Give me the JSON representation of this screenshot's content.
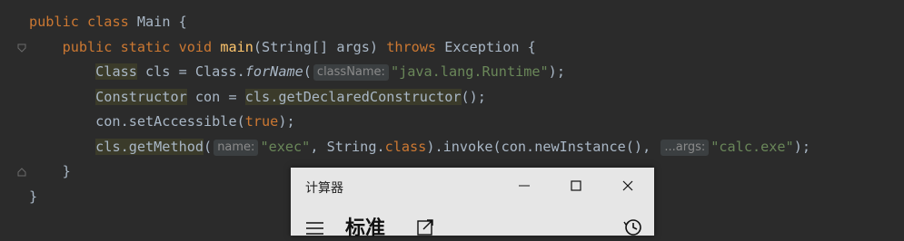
{
  "editor": {
    "lines": [
      {
        "tokens": [
          {
            "t": "public ",
            "c": "kw"
          },
          {
            "t": "class ",
            "c": "kw"
          },
          {
            "t": "Main {",
            "c": ""
          }
        ]
      },
      {
        "tokens": [
          {
            "t": "    public ",
            "c": "kw"
          },
          {
            "t": "static ",
            "c": "kw"
          },
          {
            "t": "void ",
            "c": "kw"
          },
          {
            "t": "main",
            "c": "fn"
          },
          {
            "t": "(String[] args) ",
            "c": ""
          },
          {
            "t": "throws ",
            "c": "kw"
          },
          {
            "t": "Exception {",
            "c": ""
          }
        ]
      },
      {
        "tokens": [
          {
            "t": "        ",
            "c": ""
          },
          {
            "t": "Class",
            "c": "hl"
          },
          {
            "t": " cls = Class.",
            "c": ""
          },
          {
            "t": "forName",
            "c": "it"
          },
          {
            "t": "(",
            "c": ""
          },
          {
            "t": "className:",
            "c": "hint"
          },
          {
            "t": "\"java.lang.Runtime\"",
            "c": "str"
          },
          {
            "t": ");",
            "c": ""
          }
        ]
      },
      {
        "tokens": [
          {
            "t": "        ",
            "c": ""
          },
          {
            "t": "Constructor",
            "c": "hl"
          },
          {
            "t": " con = ",
            "c": ""
          },
          {
            "t": "cls.getDeclaredConstructor",
            "c": "hl"
          },
          {
            "t": "();",
            "c": ""
          }
        ]
      },
      {
        "tokens": [
          {
            "t": "        con.setAccessible(",
            "c": ""
          },
          {
            "t": "true",
            "c": "kw"
          },
          {
            "t": ");",
            "c": ""
          }
        ]
      },
      {
        "tokens": [
          {
            "t": "        ",
            "c": ""
          },
          {
            "t": "cls.getMethod",
            "c": "hl"
          },
          {
            "t": "(",
            "c": ""
          },
          {
            "t": "name:",
            "c": "hint"
          },
          {
            "t": "\"exec\"",
            "c": "str"
          },
          {
            "t": ", String.",
            "c": ""
          },
          {
            "t": "class",
            "c": "kw"
          },
          {
            "t": ").invoke(con.newInstance(), ",
            "c": ""
          },
          {
            "t": "...args:",
            "c": "hint"
          },
          {
            "t": "\"calc.exe\"",
            "c": "str"
          },
          {
            "t": ");",
            "c": ""
          }
        ]
      },
      {
        "tokens": [
          {
            "t": "    }",
            "c": ""
          }
        ]
      },
      {
        "tokens": [
          {
            "t": "}",
            "c": ""
          }
        ]
      }
    ]
  },
  "calculator": {
    "title": "计算器",
    "mode": "标准",
    "icons": {
      "menu": "hamburger-icon",
      "keep_on_top": "keep-on-top-icon",
      "history": "history-icon",
      "minimize": "minimize-icon",
      "maximize": "maximize-icon",
      "close": "close-icon"
    }
  },
  "colors": {
    "editor_bg": "#2b2b2b",
    "keyword": "#cc7832",
    "function": "#ffc66d",
    "string": "#6a8759",
    "text": "#a9b7c6",
    "calculator_bg": "#e6e6e6"
  }
}
